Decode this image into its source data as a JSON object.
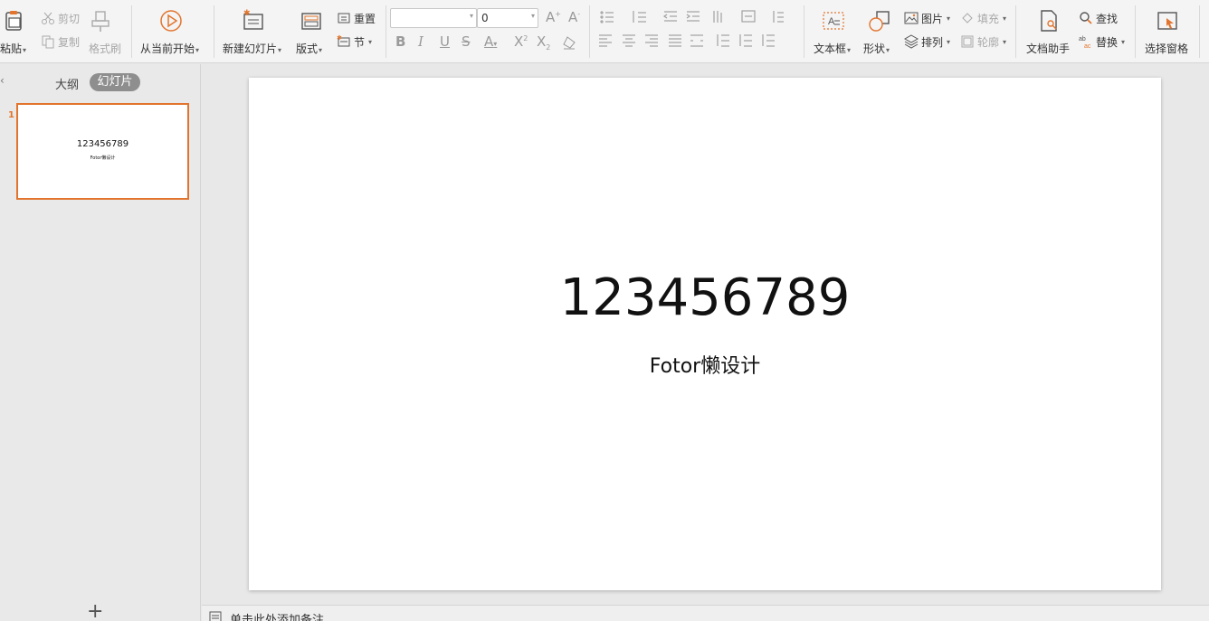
{
  "ribbon": {
    "clipboard": {
      "paste": "粘贴",
      "cut": "剪切",
      "copy": "复制",
      "format_painter": "格式刷"
    },
    "play_from_current": "从当前开始",
    "new_slide": "新建幻灯片",
    "layout": "版式",
    "reset": "重置",
    "section": "节",
    "font_name": "",
    "font_size": "0",
    "textbox": "文本框",
    "shape": "形状",
    "picture": "图片",
    "fill": "填充",
    "arrange": "排列",
    "outline": "轮廓",
    "doc_assistant": "文档助手",
    "find": "查找",
    "replace": "替换",
    "selection_pane": "选择窗格"
  },
  "left_panel": {
    "tab_outline": "大纲",
    "tab_slides": "幻灯片",
    "slides": [
      {
        "number": "1",
        "title": "123456789",
        "subtitle": "Fotor懒设计"
      }
    ]
  },
  "slide": {
    "title": "123456789",
    "subtitle": "Fotor懒设计"
  },
  "notes": {
    "placeholder": "单击此处添加备注"
  },
  "colors": {
    "accent": "#e2742d",
    "ribbon_bg": "#f4f4f4",
    "workspace_bg": "#e8e8e8"
  }
}
